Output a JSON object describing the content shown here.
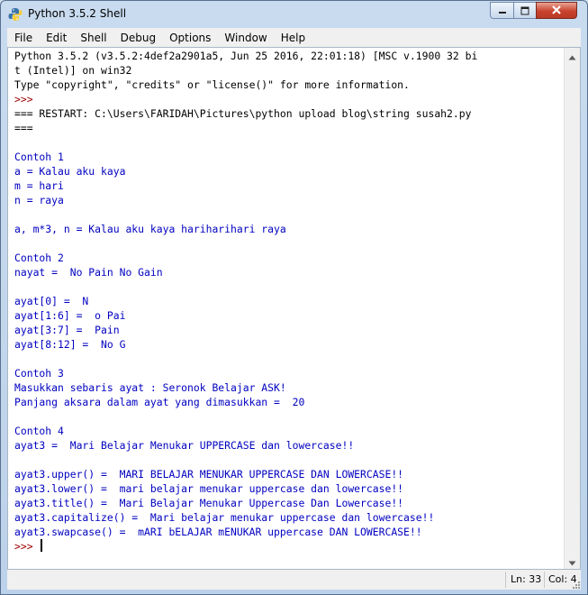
{
  "window": {
    "title": "Python 3.5.2 Shell",
    "icon": "python-icon"
  },
  "menu": [
    "File",
    "Edit",
    "Shell",
    "Debug",
    "Options",
    "Window",
    "Help"
  ],
  "shell": {
    "lines": [
      {
        "text": "Python 3.5.2 (v3.5.2:4def2a2901a5, Jun 25 2016, 22:01:18) [MSC v.1900 32 bi",
        "style": "out"
      },
      {
        "text": "t (Intel)] on win32",
        "style": "out"
      },
      {
        "text": "Type \"copyright\", \"credits\" or \"license()\" for more information.",
        "style": "out"
      },
      {
        "text": ">>> ",
        "style": "prompt"
      },
      {
        "text": "=== RESTART: C:\\Users\\FARIDAH\\Pictures\\python upload blog\\string susah2.py",
        "style": "out"
      },
      {
        "text": "===",
        "style": "out"
      },
      {
        "text": "",
        "style": "blue"
      },
      {
        "text": "Contoh 1",
        "style": "blue"
      },
      {
        "text": "a = Kalau aku kaya",
        "style": "blue"
      },
      {
        "text": "m = hari",
        "style": "blue"
      },
      {
        "text": "n = raya",
        "style": "blue"
      },
      {
        "text": "",
        "style": "blue"
      },
      {
        "text": "a, m*3, n = Kalau aku kaya hariharihari raya",
        "style": "blue"
      },
      {
        "text": "",
        "style": "blue"
      },
      {
        "text": "Contoh 2",
        "style": "blue"
      },
      {
        "text": "nayat =  No Pain No Gain",
        "style": "blue"
      },
      {
        "text": "",
        "style": "blue"
      },
      {
        "text": "ayat[0] =  N",
        "style": "blue"
      },
      {
        "text": "ayat[1:6] =  o Pai",
        "style": "blue"
      },
      {
        "text": "ayat[3:7] =  Pain",
        "style": "blue"
      },
      {
        "text": "ayat[8:12] =  No G",
        "style": "blue"
      },
      {
        "text": "",
        "style": "blue"
      },
      {
        "text": "Contoh 3",
        "style": "blue"
      },
      {
        "text": "Masukkan sebaris ayat : Seronok Belajar ASK!",
        "style": "blue"
      },
      {
        "text": "Panjang aksara dalam ayat yang dimasukkan =  20",
        "style": "blue"
      },
      {
        "text": "",
        "style": "blue"
      },
      {
        "text": "Contoh 4",
        "style": "blue"
      },
      {
        "text": "ayat3 =  Mari Belajar Menukar UPPERCASE dan lowercase!!",
        "style": "blue"
      },
      {
        "text": "",
        "style": "blue"
      },
      {
        "text": "ayat3.upper() =  MARI BELAJAR MENUKAR UPPERCASE DAN LOWERCASE!!",
        "style": "blue"
      },
      {
        "text": "ayat3.lower() =  mari belajar menukar uppercase dan lowercase!!",
        "style": "blue"
      },
      {
        "text": "ayat3.title() =  Mari Belajar Menukar Uppercase Dan Lowercase!!",
        "style": "blue"
      },
      {
        "text": "ayat3.capitalize() =  Mari belajar menukar uppercase dan lowercase!!",
        "style": "blue"
      },
      {
        "text": "ayat3.swapcase() =  mARI bELAJAR mENUKAR uppercase DAN LOWERCASE!!",
        "style": "blue"
      },
      {
        "text": ">>> ",
        "style": "prompt",
        "cursor": true
      }
    ]
  },
  "status": {
    "line": "Ln: 33",
    "col": "Col: 4"
  },
  "colors": {
    "output": "#000000",
    "stdout": "#0000c0",
    "prompt": "#a00000"
  }
}
